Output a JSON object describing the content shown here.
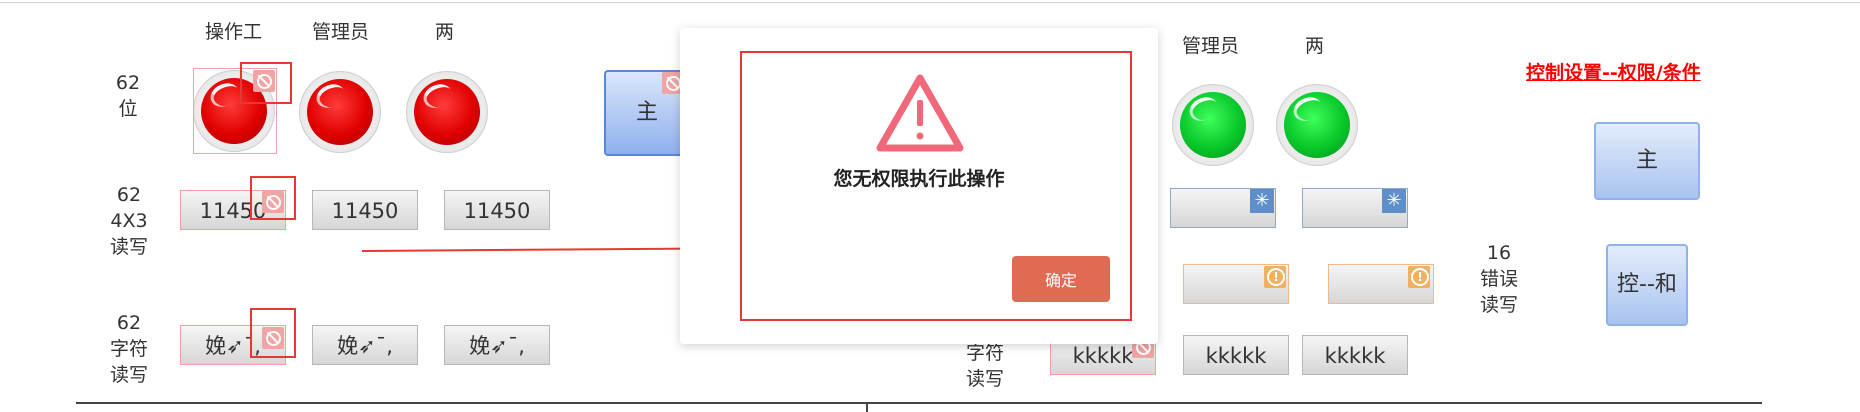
{
  "columns": {
    "operator": "操作工",
    "manager": "管理员",
    "both": "两"
  },
  "rows": {
    "r1": [
      "62",
      "位"
    ],
    "r2": [
      "62",
      "4X3",
      "读写"
    ],
    "r3": [
      "62",
      "字符",
      "读写"
    ],
    "r4": [
      "16",
      "错误",
      "读写"
    ],
    "r5": [
      "字符",
      "读写"
    ]
  },
  "values": {
    "num": "11450",
    "str": "娩➶¯,",
    "kk": "kkkkk"
  },
  "buttons": {
    "main": "主",
    "main_right": "主",
    "ctrl": "控--和"
  },
  "link": {
    "control_settings": "控制设置--权限/条件"
  },
  "modal": {
    "message": "您无权限执行此操作",
    "ok_label": "确定"
  },
  "colors": {
    "accent_red": "#e53935",
    "link_red": "#ff0000",
    "ok_button": "#e06a52",
    "lamp_red": "#e00000",
    "lamp_green": "#08c82a"
  },
  "icons": [
    "ban-icon",
    "warning-triangle-icon",
    "spark-icon",
    "alert-circle-icon"
  ]
}
